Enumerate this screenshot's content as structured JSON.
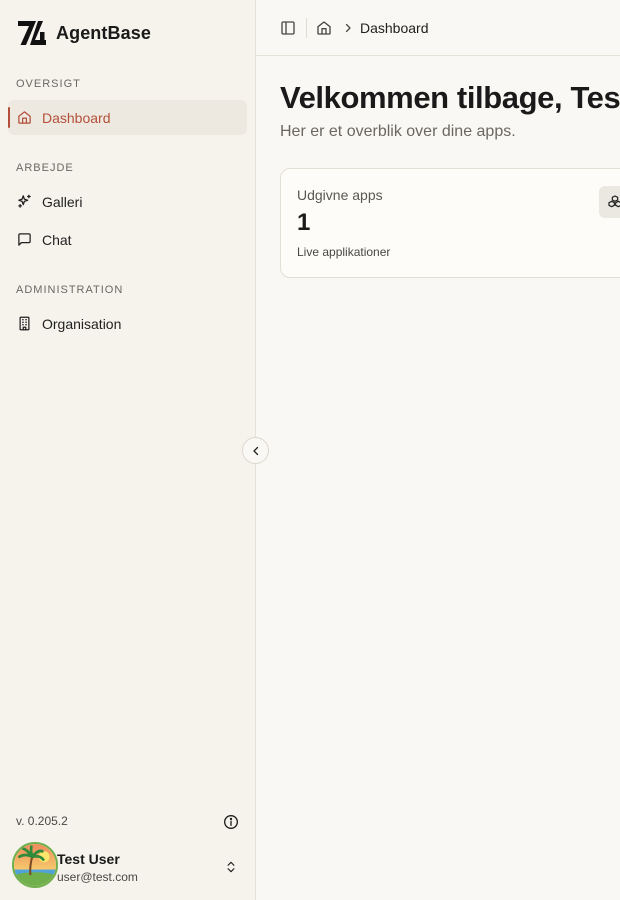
{
  "brand": {
    "name": "AgentBase",
    "logo_icon": "agentbase-logo"
  },
  "sidebar": {
    "sections": [
      {
        "label": "OVERSIGT",
        "items": [
          {
            "label": "Dashboard",
            "icon": "home-icon",
            "active": true
          }
        ]
      },
      {
        "label": "ARBEJDE",
        "items": [
          {
            "label": "Galleri",
            "icon": "sparkles-icon",
            "active": false
          },
          {
            "label": "Chat",
            "icon": "message-square-icon",
            "active": false
          }
        ]
      },
      {
        "label": "ADMINISTRATION",
        "items": [
          {
            "label": "Organisation",
            "icon": "building-icon",
            "active": false
          }
        ]
      }
    ],
    "version": "v. 0.205.2",
    "user": {
      "name": "Test User",
      "email": "user@test.com"
    }
  },
  "topbar": {
    "breadcrumb": "Dashboard"
  },
  "main": {
    "title": "Velkommen tilbage, Test",
    "subtitle": "Her er et overblik over dine apps.",
    "cards": [
      {
        "title": "Udgivne apps",
        "value": "1",
        "description": "Live applikationer",
        "icon": "boxes-icon"
      }
    ]
  },
  "colors": {
    "accent": "#b4503a",
    "background": "#faf8f4",
    "sidebar": "#f6f3ec"
  }
}
